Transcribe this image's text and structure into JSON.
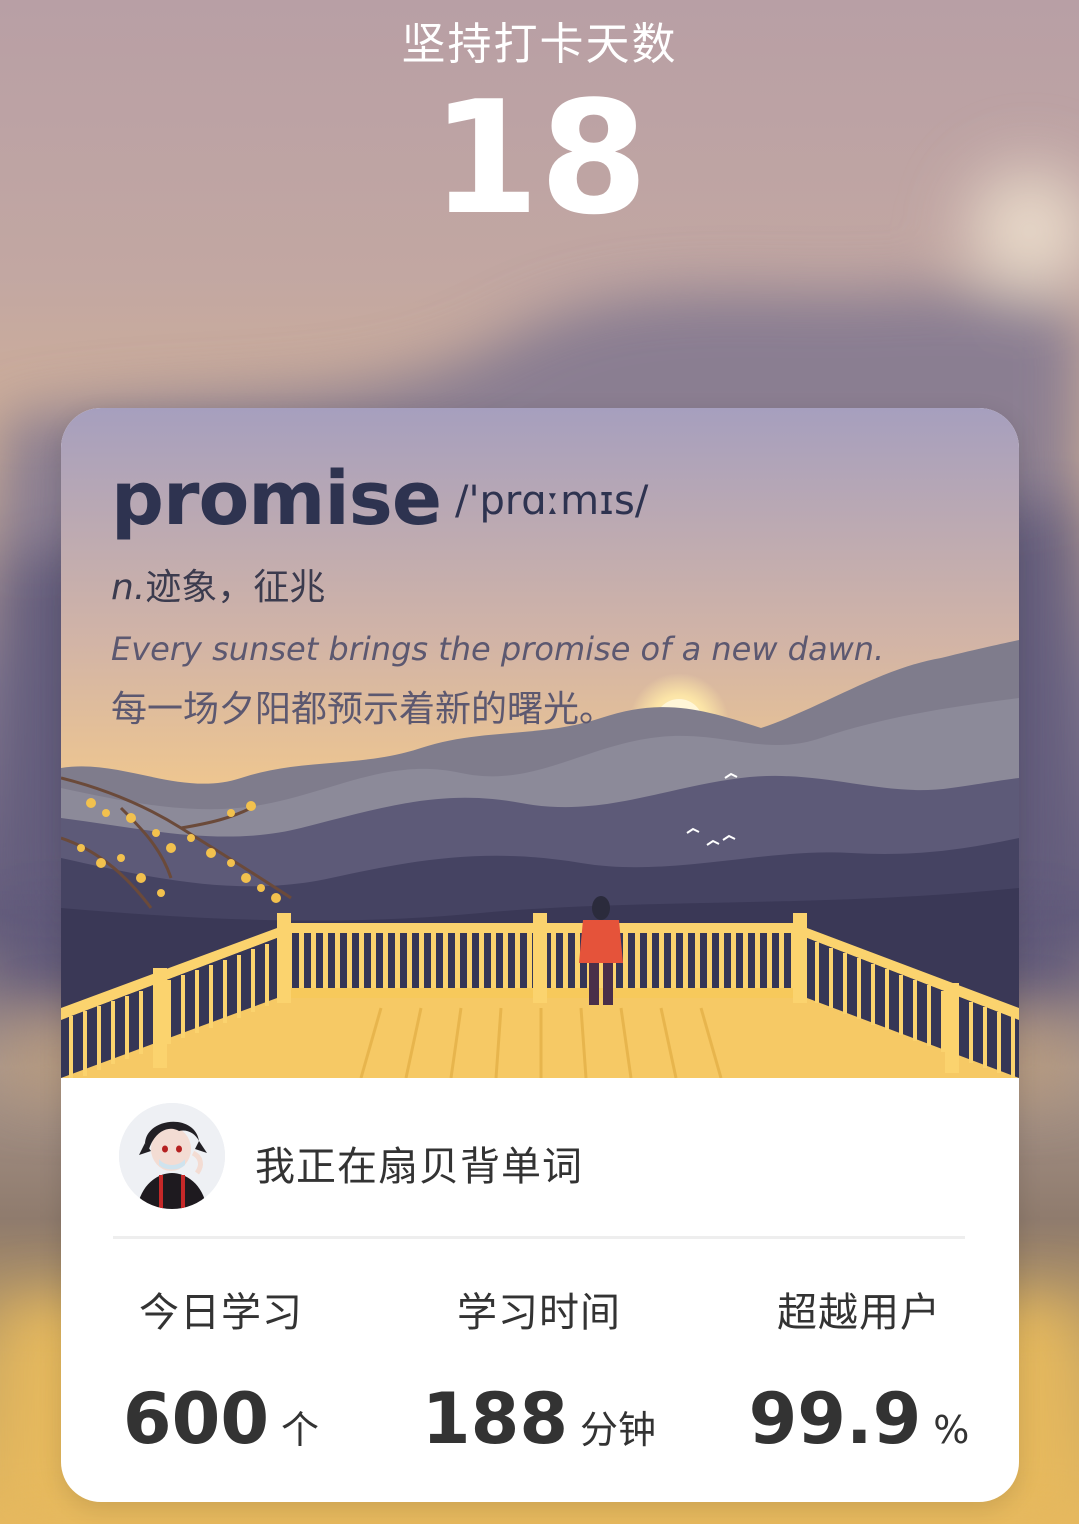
{
  "header": {
    "title": "坚持打卡天数",
    "days": "18"
  },
  "card": {
    "word": "promise",
    "phonetic": "/'prɑːmɪs/",
    "definition_pos": "n.",
    "definition_text": "迹象，征兆",
    "example_en": "Every sunset brings the promise of a new dawn.",
    "example_zh": "每一场夕阳都预示着新的曙光。"
  },
  "user": {
    "status_text": "我正在扇贝背单词"
  },
  "stats": [
    {
      "label": "今日学习",
      "value": "600",
      "unit": "个"
    },
    {
      "label": "学习时间",
      "value": "188",
      "unit": "分钟"
    },
    {
      "label": "超越用户",
      "value": "99.9",
      "unit": "%"
    }
  ],
  "colors": {
    "word": "#2e3350",
    "text_dark": "#333333",
    "sky_top": "#a79fbd",
    "sky_bottom": "#f1c57b",
    "deck": "#f7c95f",
    "mountain_dark": "#4a4866"
  },
  "icons": {
    "avatar": "user-avatar-anime",
    "sun": "sun-icon",
    "birds": "birds-icon"
  }
}
